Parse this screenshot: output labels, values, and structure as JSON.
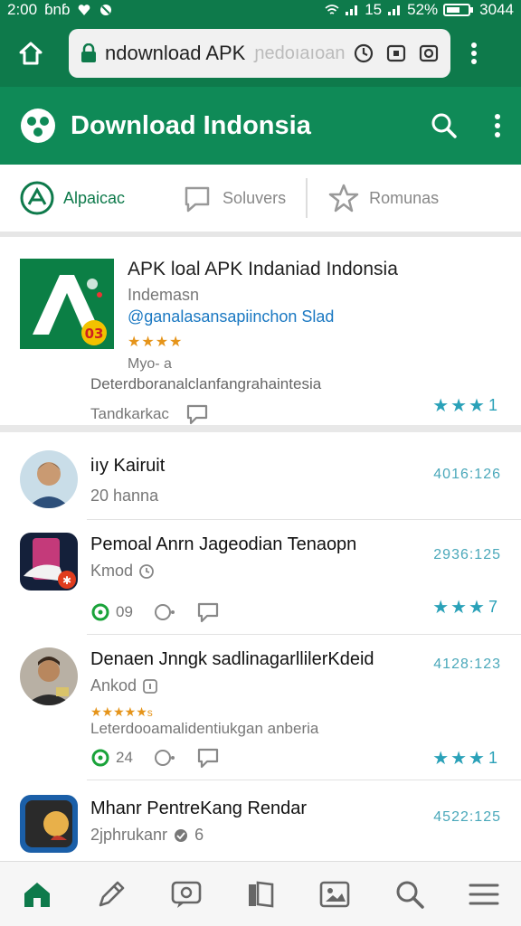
{
  "status_bar": {
    "time": "2:00",
    "carrier": "ɓnɓ",
    "signal_label": "15",
    "battery": "52%",
    "right_time": "3044"
  },
  "browser": {
    "url": "ndownload APK",
    "url_ghost": "ɲedoıaıoan"
  },
  "app": {
    "title": "Download Indonsia",
    "accent": "#0f8a57"
  },
  "tabs": [
    {
      "label": "Alpaicac",
      "active": true
    },
    {
      "label": "Soluvers",
      "active": false
    },
    {
      "label": "Romunas",
      "active": false
    }
  ],
  "featured": {
    "title": "APK loal APK Indaniad Indonsia",
    "subtitle": "Indemasn",
    "link": "@ganalasansapiinchon Slad",
    "stars": "★★★★",
    "meta": "Myo-  a",
    "description": "Deterdboranalclanfangrahaintesia",
    "footer": "Tandkarkac",
    "rating_value": "1",
    "rating_stars": "★★★",
    "badge": "03"
  },
  "items": [
    {
      "title": "iıy Kairuit",
      "subtitle": "20 hanna",
      "stamp": "4016:126"
    },
    {
      "title": "Pemoal Anrn Jageodian Tenaopn",
      "subtitle": "Kmod",
      "stamp": "2936:125",
      "likes": "09",
      "rating_value": "7",
      "rating_stars": "★★★"
    },
    {
      "title": "Denaen Jnngk sadlinagarllilerKdeid",
      "subtitle": "Ankod",
      "stamp": "4128:123",
      "stars": "★★★★★",
      "stars_suffix": "s",
      "description": "Leterdooamalidentiukgan anberia",
      "likes": "24",
      "rating_value": "1",
      "rating_stars": "★★★"
    },
    {
      "title": "Mhanr PentreKang Rendar",
      "subtitle": "2jphrukanr",
      "sub_count": "6",
      "stamp": "4522:125"
    }
  ],
  "bottom_nav": [
    "home-icon",
    "edit-icon",
    "chat-icon",
    "library-icon",
    "gallery-icon",
    "search-icon",
    "menu-icon"
  ]
}
